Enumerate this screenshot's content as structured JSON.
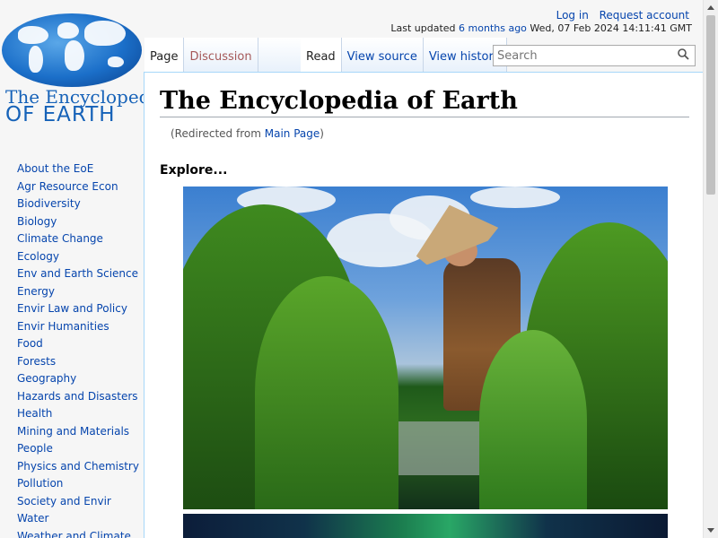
{
  "logo": {
    "line1": "The Encyclopedia",
    "line2": "OF EARTH"
  },
  "personal_tools": {
    "login": "Log in",
    "request_account": "Request account"
  },
  "last_updated": {
    "prefix": "Last updated",
    "relative": "6 months ago",
    "datetime": "Wed, 07 Feb 2024 14:11:41 GMT"
  },
  "tabs": {
    "page": "Page",
    "discussion": "Discussion",
    "read": "Read",
    "view_source": "View source",
    "view_history": "View history"
  },
  "search": {
    "placeholder": "Search"
  },
  "sidebar": {
    "items": [
      "About the EoE",
      "Agr Resource Econ",
      "Biodiversity",
      "Biology",
      "Climate Change",
      "Ecology",
      "Env and Earth Science",
      "Energy",
      "Envir Law and Policy",
      "Envir Humanities",
      "Food",
      "Forests",
      "Geography",
      "Hazards and Disasters",
      "Health",
      "Mining and Materials",
      "People",
      "Physics and Chemistry",
      "Pollution",
      "Society and Envir",
      "Water",
      "Weather and Climate"
    ]
  },
  "content": {
    "title": "The Encyclopedia of Earth",
    "redirect_open": "(Redirected from ",
    "redirect_link": "Main Page",
    "redirect_close": ")",
    "explore": "Explore..."
  },
  "colors": {
    "link": "#0645ad",
    "visited_red": "#a55858",
    "border": "#a7d7f9"
  }
}
